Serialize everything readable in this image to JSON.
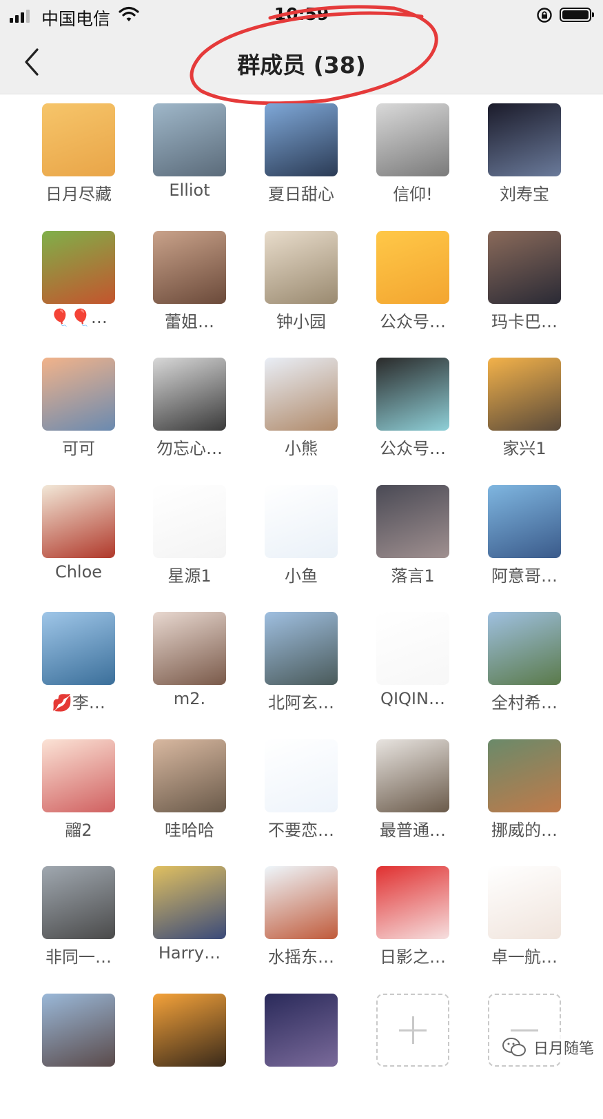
{
  "status_bar": {
    "carrier": "中国电信",
    "time": "10:59"
  },
  "nav": {
    "title": "群成员 (38)"
  },
  "members": [
    {
      "name": "日月尽藏",
      "colors": [
        "#f6c56a",
        "#e9a548"
      ]
    },
    {
      "name": "Elliot",
      "colors": [
        "#9fb7c9",
        "#5b6b7a"
      ]
    },
    {
      "name": "夏日甜心",
      "colors": [
        "#7fa8d8",
        "#2b3b55"
      ]
    },
    {
      "name": "信仰!",
      "colors": [
        "#d9d9d9",
        "#7a7a7a"
      ]
    },
    {
      "name": "刘寿宝",
      "colors": [
        "#1b1b2a",
        "#6a7a9a"
      ]
    },
    {
      "name": "🎈🎈…",
      "colors": [
        "#7fb04a",
        "#c4542d"
      ]
    },
    {
      "name": "蕾姐…",
      "colors": [
        "#c9a28a",
        "#6b4a3a"
      ]
    },
    {
      "name": "钟小园",
      "colors": [
        "#e8dccb",
        "#9a8a70"
      ]
    },
    {
      "name": "公众号…",
      "colors": [
        "#ffc848",
        "#f3a530"
      ]
    },
    {
      "name": "玛卡巴…",
      "colors": [
        "#8a6a5a",
        "#2a2a35"
      ]
    },
    {
      "name": "可可",
      "colors": [
        "#f2b38a",
        "#6a8ab0"
      ]
    },
    {
      "name": "勿忘心…",
      "colors": [
        "#d8d8d8",
        "#3a3a3a"
      ]
    },
    {
      "name": "小熊",
      "colors": [
        "#e9eef6",
        "#b08a6a"
      ]
    },
    {
      "name": "公众号…",
      "colors": [
        "#2a2a2a",
        "#8fd0d8"
      ]
    },
    {
      "name": "家兴1",
      "colors": [
        "#f3b24a",
        "#5a4a3a"
      ]
    },
    {
      "name": "Chloe",
      "colors": [
        "#f2e8d8",
        "#b0382a"
      ]
    },
    {
      "name": "星源1",
      "colors": [
        "#ffffff",
        "#f4f4f4"
      ]
    },
    {
      "name": "小鱼",
      "colors": [
        "#ffffff",
        "#eaf1f8"
      ]
    },
    {
      "name": "落言1",
      "colors": [
        "#4a4a55",
        "#a09090"
      ]
    },
    {
      "name": "阿意哥…",
      "colors": [
        "#7fb6e0",
        "#3a5a8a"
      ]
    },
    {
      "name": "💋李…",
      "colors": [
        "#9fc6e8",
        "#3b6f9a"
      ]
    },
    {
      "name": "m2.",
      "colors": [
        "#e8d8d0",
        "#7a5a4a"
      ]
    },
    {
      "name": "北阿玄…",
      "colors": [
        "#9fbfe0",
        "#4a5a5a"
      ]
    },
    {
      "name": "QIQIN…",
      "colors": [
        "#ffffff",
        "#f7f7f7"
      ]
    },
    {
      "name": "全村希…",
      "colors": [
        "#9fc0e0",
        "#5a7a4a"
      ]
    },
    {
      "name": "鬸2",
      "colors": [
        "#fbe3d6",
        "#d06060"
      ]
    },
    {
      "name": "哇哈哈",
      "colors": [
        "#d8b8a0",
        "#6a5a4a"
      ]
    },
    {
      "name": "不要恋…",
      "colors": [
        "#ffffff",
        "#eef4fb"
      ]
    },
    {
      "name": "最普通…",
      "colors": [
        "#e8e4e0",
        "#6a5a4a"
      ]
    },
    {
      "name": "挪威的…",
      "colors": [
        "#6a8a6a",
        "#c07a4a"
      ]
    },
    {
      "name": "非同一…",
      "colors": [
        "#a0a8b0",
        "#4a4a4a"
      ]
    },
    {
      "name": "Harry…",
      "colors": [
        "#e0c060",
        "#3a4a7a"
      ]
    },
    {
      "name": "水摇东…",
      "colors": [
        "#eef6fb",
        "#c05a3a"
      ]
    },
    {
      "name": "日影之…",
      "colors": [
        "#e03030",
        "#f6e0e0"
      ]
    },
    {
      "name": "卓一航…",
      "colors": [
        "#ffffff",
        "#f0e4dc"
      ]
    },
    {
      "name": "",
      "colors": [
        "#9ab8d8",
        "#5a4a4a"
      ]
    },
    {
      "name": "",
      "colors": [
        "#f4a23a",
        "#3a2a1a"
      ]
    },
    {
      "name": "",
      "colors": [
        "#2a2a5a",
        "#7a6a9a"
      ]
    }
  ],
  "actions": {
    "add_icon": "plus-icon",
    "remove_icon": "minus-icon"
  },
  "watermark": {
    "text": "日月随笔"
  }
}
